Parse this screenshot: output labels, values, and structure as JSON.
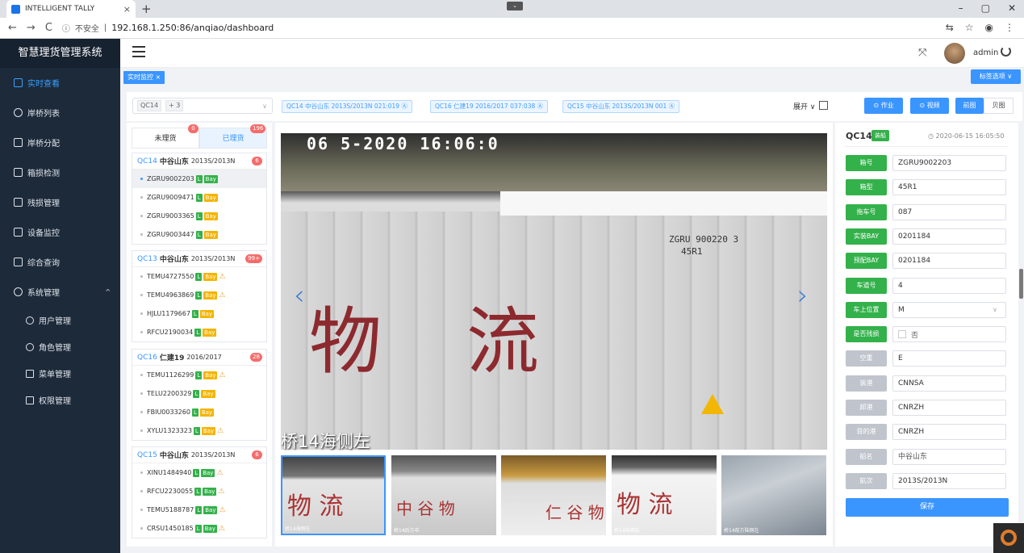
{
  "browser": {
    "tab_title": "INTELLIGENT TALLY",
    "tab_close": "×",
    "new_tab": "+",
    "security": "不安全",
    "url": "192.168.1.250:86/anqiao/dashboard",
    "window_controls": [
      "–",
      "▢",
      "✕"
    ],
    "nav_back": "←",
    "nav_forward": "→",
    "nav_reload": "C",
    "info_icon": "ⓘ"
  },
  "sidebar": {
    "brand": "智慧理货管理系统",
    "items": [
      {
        "label": "实时查看",
        "active": true
      },
      {
        "label": "岸桥列表"
      },
      {
        "label": "岸桥分配"
      },
      {
        "label": "箱损检测"
      },
      {
        "label": "残损管理"
      },
      {
        "label": "设备监控"
      },
      {
        "label": "综合查询"
      },
      {
        "label": "系统管理",
        "expanded": true
      }
    ],
    "subitems": [
      "用户管理",
      "角色管理",
      "菜单管理",
      "权限管理"
    ],
    "expand_arrow": "^"
  },
  "header": {
    "user": "admin",
    "fullscreen_icon": "⤧"
  },
  "tags": {
    "active_tag": "实时监控 ×",
    "tag_options": "标签选项 ∨"
  },
  "filter": {
    "selected_crane": "QC14",
    "more_count": "+ 3",
    "crane_tags": [
      "QC14  中谷山东  2013S/2013N  021:019 Ⓐ",
      "QC16  仁建19  2016/2017  037:038 Ⓐ",
      "QC15  中谷山东  2013S/2013N  001 Ⓐ"
    ],
    "expand_label": "展开 ∨",
    "buttons": {
      "work": "⊙ 作业",
      "video": "⊙ 视频",
      "front": "前图",
      "page": "贝图"
    }
  },
  "list": {
    "tab_pending": "未理货",
    "tab_pending_count": "0",
    "tab_done": "已理货",
    "tab_done_count": "196",
    "groups": [
      {
        "qc": "QC14",
        "ship": "中谷山东",
        "voyage": "2013S/2013N",
        "count": "6",
        "items": [
          {
            "no": "ZGRU9002203",
            "bay": "Bay",
            "bay_color": "green",
            "warn": false,
            "selected": true
          },
          {
            "no": "ZGRU9009471",
            "bay": "Bay",
            "bay_color": "yellow",
            "warn": false
          },
          {
            "no": "ZGRU9003365",
            "bay": "Bay",
            "bay_color": "yellow",
            "warn": false
          },
          {
            "no": "ZGRU9003447",
            "bay": "Bay",
            "bay_color": "yellow",
            "warn": false
          }
        ]
      },
      {
        "qc": "QC13",
        "ship": "中谷山东",
        "voyage": "2013S/2013N",
        "count": "99+",
        "items": [
          {
            "no": "TEMU4727550",
            "bay": "Bay",
            "bay_color": "yellow",
            "warn": true
          },
          {
            "no": "TEMU4963869",
            "bay": "Bay",
            "bay_color": "yellow",
            "warn": true
          },
          {
            "no": "HJLU1179667",
            "bay": "Bay",
            "bay_color": "yellow",
            "warn": false
          },
          {
            "no": "RFCU2190034",
            "bay": "Bay",
            "bay_color": "yellow",
            "warn": false
          }
        ]
      },
      {
        "qc": "QC16",
        "ship": "仁建19",
        "voyage": "2016/2017",
        "count": "28",
        "items": [
          {
            "no": "TEMU1126299",
            "bay": "Bay",
            "bay_color": "yellow",
            "warn": true
          },
          {
            "no": "TELU2200329",
            "bay": "Bay",
            "bay_color": "yellow",
            "warn": false
          },
          {
            "no": "FBIU0033260",
            "bay": "Bay",
            "bay_color": "yellow",
            "warn": false
          },
          {
            "no": "XYLU1323323",
            "bay": "Bay",
            "bay_color": "yellow",
            "warn": true
          }
        ]
      },
      {
        "qc": "QC15",
        "ship": "中谷山东",
        "voyage": "2013S/2013N",
        "count": "6",
        "items": [
          {
            "no": "XINU1484940",
            "bay": "Bay",
            "bay_color": "green",
            "warn": true
          },
          {
            "no": "RFCU2230055",
            "bay": "Bay",
            "bay_color": "green",
            "warn": true
          },
          {
            "no": "TEMU5188787",
            "bay": "Bay",
            "bay_color": "green",
            "warn": true
          },
          {
            "no": "CRSU1450185",
            "bay": "Bay",
            "bay_color": "green",
            "warn": true
          }
        ]
      }
    ],
    "L": "L",
    "warn_icon": "⚠"
  },
  "image": {
    "timestamp": "06  5-2020  16:06:0",
    "container_line1": "ZGRU  900220 3",
    "container_line2": "45R1",
    "char1": "物",
    "char2": "流",
    "camera_label": "桥14海侧左",
    "prev": "‹",
    "next": "›",
    "thumb_labels": [
      "桥14海侧左",
      "桥14后方中",
      "",
      "桥14陆侧右",
      "桥14前方陆侧左"
    ],
    "thumb_chars": [
      "物 流",
      "中 谷 物",
      "仁 谷 物",
      "物 流",
      ""
    ]
  },
  "form": {
    "qc": "QC14",
    "status": "装船",
    "time": "◷ 2020-06-15 16:05:50",
    "fields": [
      {
        "label": "箱号",
        "value": "ZGRU9002203"
      },
      {
        "label": "箱型",
        "value": "45R1"
      },
      {
        "label": "拖车号",
        "value": "087"
      },
      {
        "label": "实装BAY",
        "value": "0201184"
      },
      {
        "label": "预配BAY",
        "value": "0201184"
      },
      {
        "label": "车道号",
        "value": "4"
      },
      {
        "label": "车上位置",
        "value": "M"
      },
      {
        "label": "是否残损",
        "value": ""
      },
      {
        "label": "空重",
        "value": "E"
      },
      {
        "label": "装港",
        "value": "CNNSA"
      },
      {
        "label": "卸港",
        "value": "CNRZH"
      },
      {
        "label": "目的港",
        "value": "CNRZH"
      },
      {
        "label": "船名",
        "value": "中谷山东"
      },
      {
        "label": "航次",
        "value": "2013S/2013N"
      }
    ],
    "damage_option": "否",
    "save": "保存"
  }
}
